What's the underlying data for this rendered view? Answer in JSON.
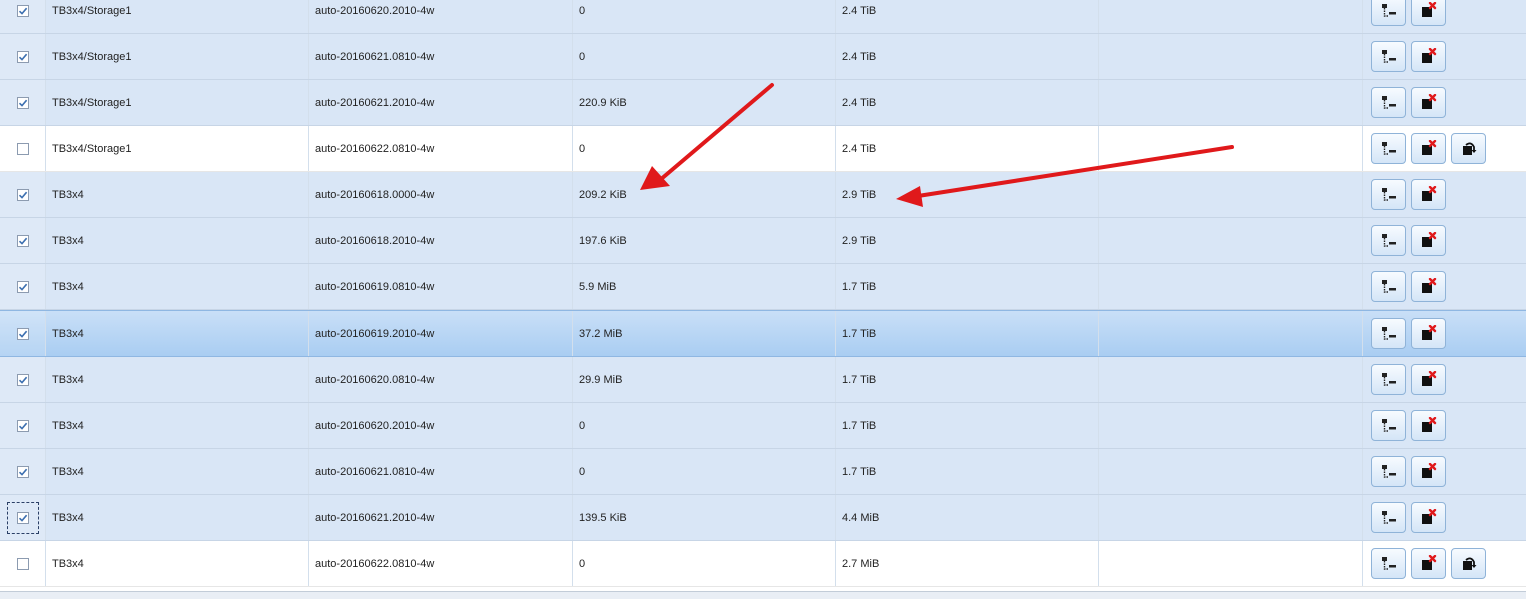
{
  "rows": [
    {
      "checked": true,
      "dataset": "TB3x4/Storage1",
      "snapshot": "auto-20160620.2010-4w",
      "used": "0",
      "refer": "2.4 TiB",
      "rollback": false
    },
    {
      "checked": true,
      "dataset": "TB3x4/Storage1",
      "snapshot": "auto-20160621.0810-4w",
      "used": "0",
      "refer": "2.4 TiB",
      "rollback": false
    },
    {
      "checked": true,
      "dataset": "TB3x4/Storage1",
      "snapshot": "auto-20160621.2010-4w",
      "used": "220.9 KiB",
      "refer": "2.4 TiB",
      "rollback": false
    },
    {
      "checked": false,
      "dataset": "TB3x4/Storage1",
      "snapshot": "auto-20160622.0810-4w",
      "used": "0",
      "refer": "2.4 TiB",
      "rollback": true
    },
    {
      "checked": true,
      "dataset": "TB3x4",
      "snapshot": "auto-20160618.0000-4w",
      "used": "209.2 KiB",
      "refer": "2.9 TiB",
      "rollback": false
    },
    {
      "checked": true,
      "dataset": "TB3x4",
      "snapshot": "auto-20160618.2010-4w",
      "used": "197.6 KiB",
      "refer": "2.9 TiB",
      "rollback": false
    },
    {
      "checked": true,
      "dataset": "TB3x4",
      "snapshot": "auto-20160619.0810-4w",
      "used": "5.9 MiB",
      "refer": "1.7 TiB",
      "rollback": false
    },
    {
      "checked": true,
      "dataset": "TB3x4",
      "snapshot": "auto-20160619.2010-4w",
      "used": "37.2 MiB",
      "refer": "1.7 TiB",
      "rollback": false,
      "selected": true
    },
    {
      "checked": true,
      "dataset": "TB3x4",
      "snapshot": "auto-20160620.0810-4w",
      "used": "29.9 MiB",
      "refer": "1.7 TiB",
      "rollback": false
    },
    {
      "checked": true,
      "dataset": "TB3x4",
      "snapshot": "auto-20160620.2010-4w",
      "used": "0",
      "refer": "1.7 TiB",
      "rollback": false
    },
    {
      "checked": true,
      "dataset": "TB3x4",
      "snapshot": "auto-20160621.0810-4w",
      "used": "0",
      "refer": "1.7 TiB",
      "rollback": false
    },
    {
      "checked": true,
      "dataset": "TB3x4",
      "snapshot": "auto-20160621.2010-4w",
      "used": "139.5 KiB",
      "refer": "4.4 MiB",
      "rollback": false,
      "focused": true
    },
    {
      "checked": false,
      "dataset": "TB3x4",
      "snapshot": "auto-20160622.0810-4w",
      "used": "0",
      "refer": "2.7 MiB",
      "rollback": true
    }
  ],
  "icons": {
    "clone": "clone-icon",
    "destroy": "destroy-icon",
    "rollback": "rollback-icon"
  },
  "colors": {
    "checked_row": "#d9e6f6",
    "unchecked_row": "#ffffff",
    "selected_row": "#a9cdf2",
    "annotation_arrow": "#e0191b"
  }
}
